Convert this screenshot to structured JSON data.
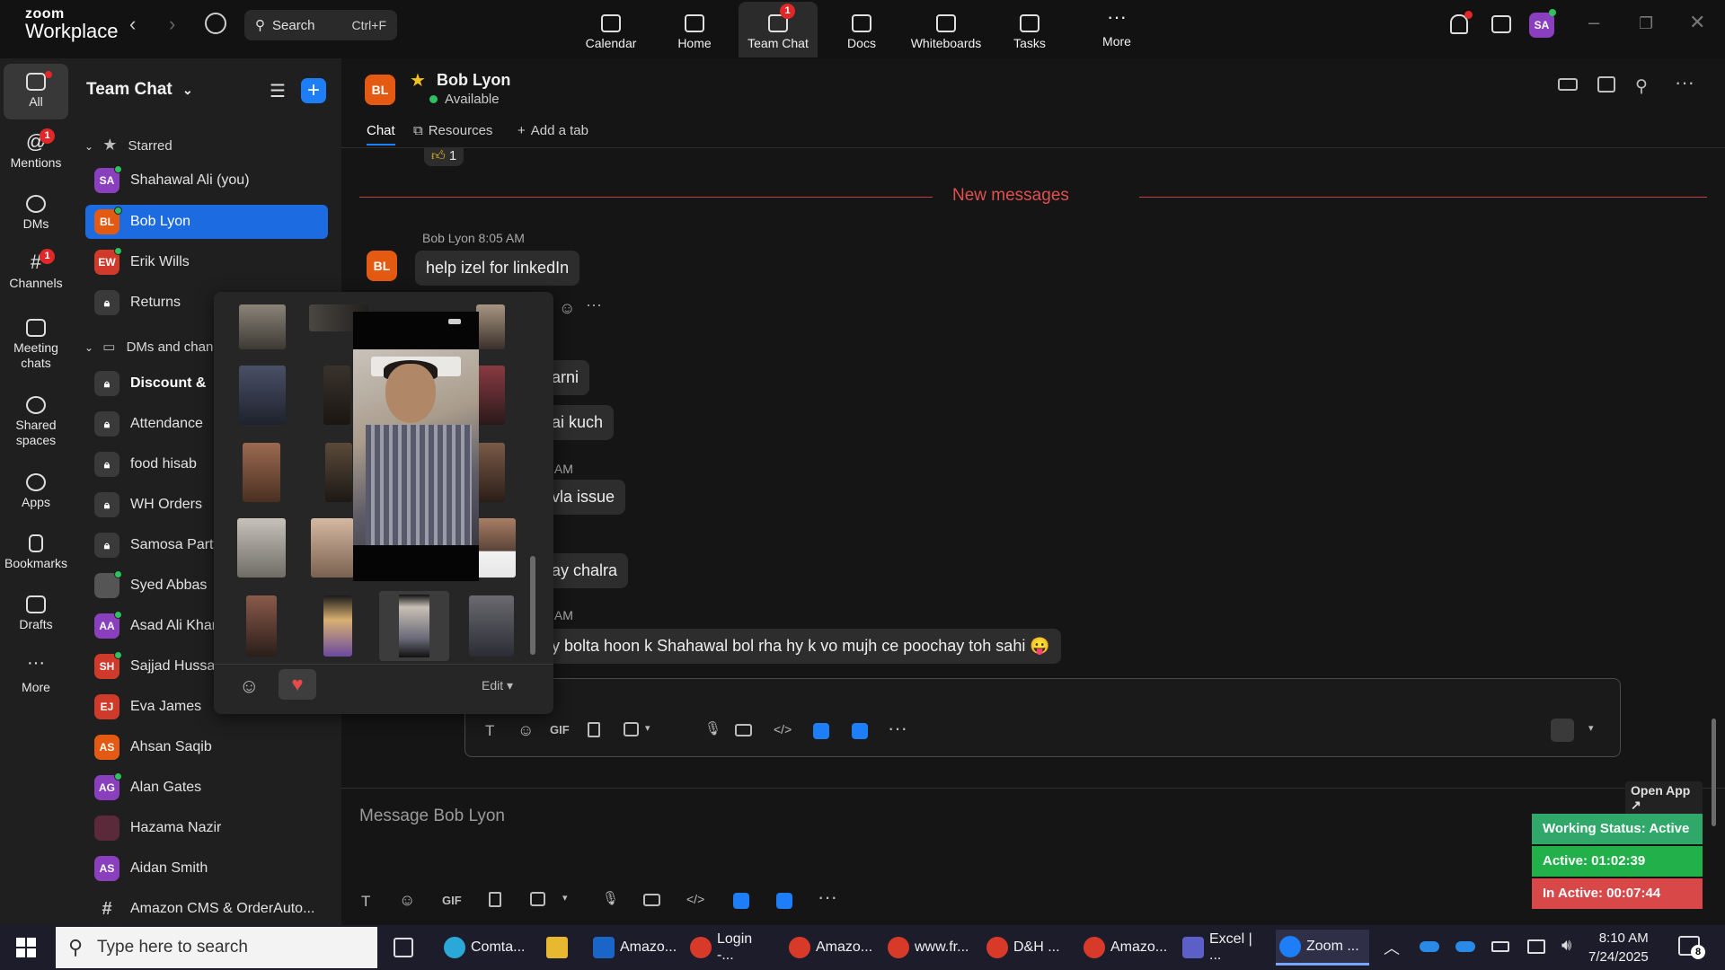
{
  "app": {
    "brand_small": "zoom",
    "brand_big": "Workplace"
  },
  "topbar": {
    "search_label": "Search",
    "search_shortcut": "Ctrl+F",
    "nav": [
      {
        "label": "Calendar"
      },
      {
        "label": "Home"
      },
      {
        "label": "Team Chat",
        "badge": "1"
      },
      {
        "label": "Docs"
      },
      {
        "label": "Whiteboards"
      },
      {
        "label": "Tasks"
      },
      {
        "label": "More"
      }
    ],
    "avatar_initials": "SA"
  },
  "rail": [
    {
      "label": "All"
    },
    {
      "label": "Mentions",
      "badge": "1"
    },
    {
      "label": "DMs"
    },
    {
      "label": "Channels",
      "badge": "1"
    },
    {
      "label": "Meeting chats"
    },
    {
      "label": "Shared spaces"
    },
    {
      "label": "Apps"
    },
    {
      "label": "Bookmarks"
    },
    {
      "label": "Drafts"
    },
    {
      "label": "More"
    }
  ],
  "sidebar": {
    "title": "Team Chat",
    "section_starred": "Starred",
    "section_dms": "DMs and chan",
    "starred": [
      {
        "initials": "SA",
        "name": "Shahawal Ali (you)",
        "color": "#8a3fbf"
      },
      {
        "initials": "BL",
        "name": "Bob Lyon",
        "color": "#e55a12"
      },
      {
        "initials": "EW",
        "name": "Erik Wills",
        "color": "#d03a2a"
      },
      {
        "initials": "",
        "name": "Returns",
        "color": "#3a3a3a"
      }
    ],
    "dms": [
      {
        "initials": "",
        "name": "Discount &",
        "color": "#3a3a3a"
      },
      {
        "initials": "",
        "name": "Attendance",
        "color": "#3a3a3a"
      },
      {
        "initials": "",
        "name": "food hisab",
        "color": "#3a3a3a"
      },
      {
        "initials": "",
        "name": "WH Orders",
        "color": "#3a3a3a"
      },
      {
        "initials": "",
        "name": "Samosa Party",
        "color": "#3a3a3a"
      },
      {
        "initials": "",
        "name": "Syed Abbas",
        "color": "#555555"
      },
      {
        "initials": "AA",
        "name": "Asad Ali Khan",
        "color": "#8a3fbf"
      },
      {
        "initials": "SH",
        "name": "Sajjad Hussain",
        "color": "#d03a2a"
      },
      {
        "initials": "EJ",
        "name": "Eva James",
        "color": "#d03a2a"
      },
      {
        "initials": "AS",
        "name": "Ahsan Saqib",
        "color": "#e55a12"
      },
      {
        "initials": "AG",
        "name": "Alan Gates",
        "color": "#8a3fbf"
      },
      {
        "initials": "",
        "name": "Hazama Nazir",
        "color": "#5a2a3a"
      },
      {
        "initials": "AS",
        "name": "Aidan Smith",
        "color": "#8a3fbf"
      },
      {
        "initials": "#",
        "name": "Amazon CMS & OrderAuto...",
        "color": "#1f1f1f"
      }
    ]
  },
  "chat": {
    "avatar_initials": "BL",
    "name": "Bob Lyon",
    "status": "Available",
    "tabs": {
      "chat": "Chat",
      "resources": "Resources",
      "add": "Add a tab"
    },
    "reaction_count": "1",
    "new_messages": "New messages",
    "sender1": "Bob Lyon",
    "time1": "8:05 AM",
    "msg1": "help izel for linkedIn",
    "msg2": "arni",
    "msg3": "ai kuch",
    "time3": "7 AM",
    "msg4": "vla issue",
    "msg5": "ay chalra",
    "time5": "3 AM",
    "msg6": "y bolta hoon k Shahawal bol rha hy k vo mujh ce poochay toh sahi 😛",
    "composer_placeholder": "Message Bob Lyon",
    "gif_label": "GIF"
  },
  "popover": {
    "edit_label": "Edit ▾"
  },
  "widget": {
    "open_app": "Open App ↗",
    "working_status": "Working Status: Active",
    "active": "Active: 01:02:39",
    "inactive": "In Active: 00:07:44"
  },
  "taskbar": {
    "search_placeholder": "Type here to search",
    "apps": [
      {
        "label": "Comta...",
        "color": "#2aa8d8"
      },
      {
        "label": "",
        "color": "#e8b830"
      },
      {
        "label": "Amazo...",
        "color": "#1a66c8"
      },
      {
        "label": "Login -...",
        "color": "#d83a2a"
      },
      {
        "label": "Amazo...",
        "color": "#d83a2a"
      },
      {
        "label": "www.fr...",
        "color": "#d83a2a"
      },
      {
        "label": "D&H ...",
        "color": "#d83a2a"
      },
      {
        "label": "Amazo...",
        "color": "#d83a2a"
      },
      {
        "label": "Excel | ...",
        "color": "#5b5fc7"
      },
      {
        "label": "Zoom ...",
        "color": "#1e7ef7"
      }
    ],
    "time": "8:10 AM",
    "date": "7/24/2025",
    "notif_count": "8"
  }
}
